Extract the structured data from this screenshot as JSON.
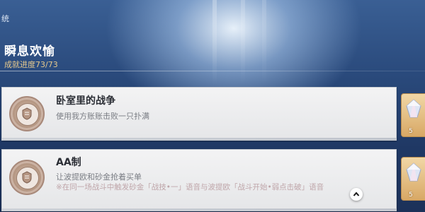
{
  "header": {
    "corner_text": "统",
    "title": "瞬息欢愉",
    "progress": "成就进度73/73"
  },
  "achievements": [
    {
      "title": "卧室里的战争",
      "description": "使用我方账账击败一只扑满",
      "reward_count": "5"
    },
    {
      "title": "AA制",
      "description": "让波提欧和砂金抢着买单",
      "note": "※在同一场战斗中触发砂金「战技•一」语音与波提欧「战斗开始•弱点击破」语音",
      "reward_count": "5"
    }
  ],
  "icons": {
    "medal": "achievement-medal-icon",
    "reward": "crystal-reward-icon",
    "collapse": "chevron-up-icon"
  },
  "colors": {
    "progress_text": "#e4c88d",
    "note_text": "#bfa5a9",
    "card_bg": "#efeff0"
  }
}
